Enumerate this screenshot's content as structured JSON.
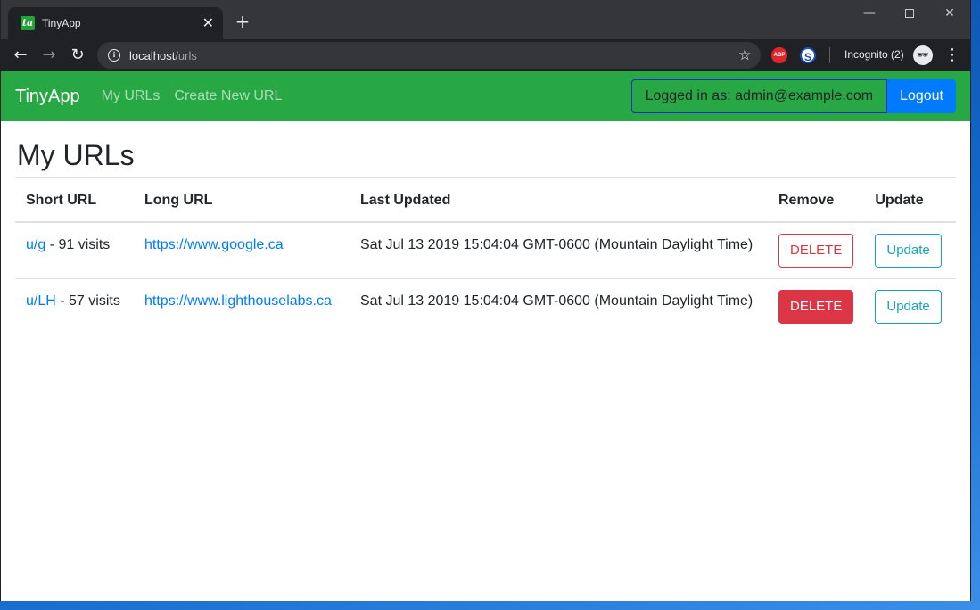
{
  "browser": {
    "tab_title": "TinyApp",
    "favicon_text": "ta",
    "favicon_color": "#22a33a",
    "tab_close": "✕",
    "new_tab": "+",
    "url_host": "localhost",
    "url_path": "/urls",
    "incognito_label": "Incognito (2)",
    "ext_abp": "ABP",
    "ext_s": "S"
  },
  "navbar": {
    "color": "#28a745",
    "brand": "TinyApp",
    "links": [
      "My URLs",
      "Create New URL"
    ],
    "logged_in": "Logged in as: admin@example.com",
    "logout": "Logout"
  },
  "main": {
    "title": "My URLs",
    "columns": [
      "Short URL",
      "Long URL",
      "Last Updated",
      "Remove",
      "Update"
    ],
    "rows": [
      {
        "short_url": "u/g",
        "visits": "- 91 visits",
        "long_url": "https://www.google.ca",
        "updated": "Sat Jul 13 2019 15:04:04 GMT-0600 (Mountain Daylight Time)",
        "delete": "DELETE",
        "update": "Update"
      },
      {
        "short_url": "u/LH",
        "visits": "- 57 visits",
        "long_url": "https://www.lighthouselabs.ca",
        "updated": "Sat Jul 13 2019 15:04:04 GMT-0600 (Mountain Daylight Time)",
        "delete": "DELETE",
        "update": "Update"
      }
    ]
  },
  "icons": {
    "back": "arrow-left-icon",
    "forward": "arrow-right-icon",
    "reload": "reload-icon",
    "info": "info-icon",
    "star": "star-icon",
    "incognito": "incognito-icon",
    "menu": "kebab-menu-icon"
  }
}
